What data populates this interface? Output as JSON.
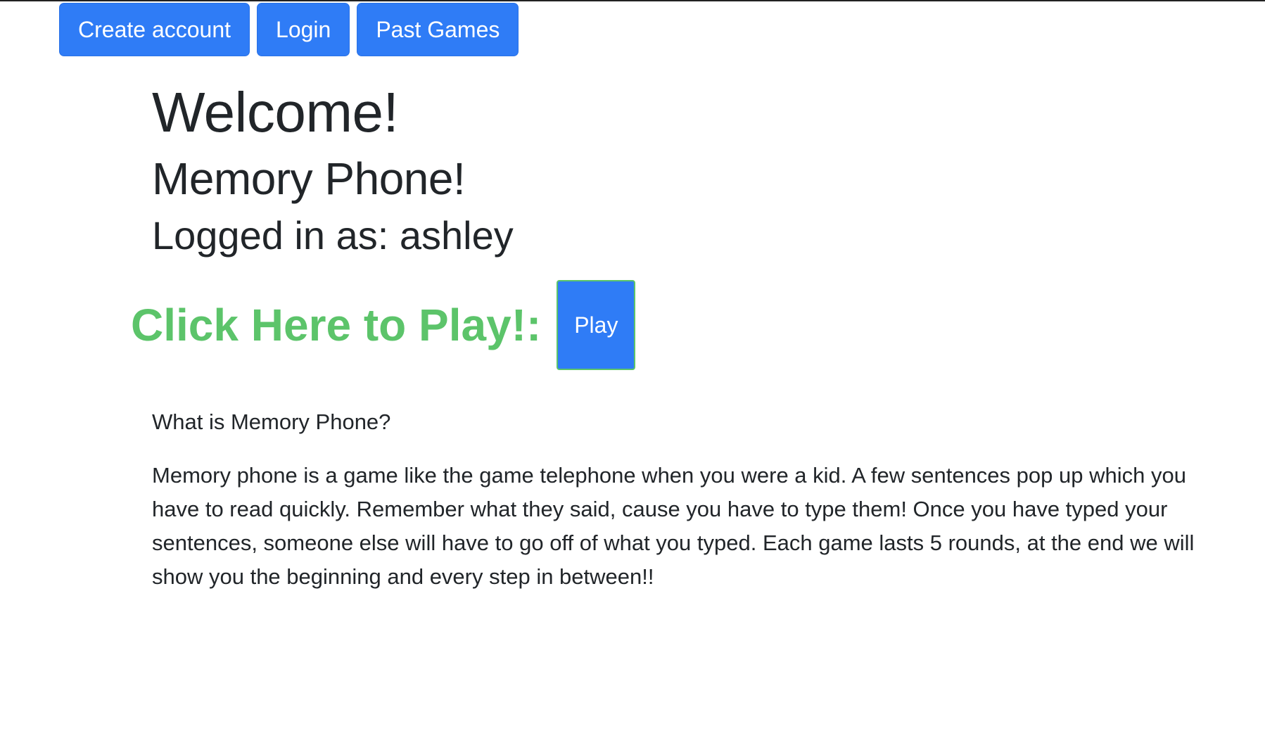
{
  "nav": {
    "create_account": "Create account",
    "login": "Login",
    "past_games": "Past Games"
  },
  "header": {
    "welcome": "Welcome!",
    "title": "Memory Phone!",
    "logged_in": "Logged in as: ashley"
  },
  "play": {
    "label": "Click Here to Play!:",
    "button": "Play"
  },
  "about": {
    "question": "What is Memory Phone?",
    "text": "Memory phone is a game like the game telephone when you were a kid. A few sentences pop up which you have to read quickly. Remember what they said, cause you have to type them! Once you have typed your sentences, someone else will have to go off of what you typed. Each game lasts 5 rounds, at the end we will show you the beginning and every step in between!!"
  },
  "colors": {
    "primary": "#2f7cf6",
    "accent_green": "#5cc46a",
    "text": "#212529"
  }
}
